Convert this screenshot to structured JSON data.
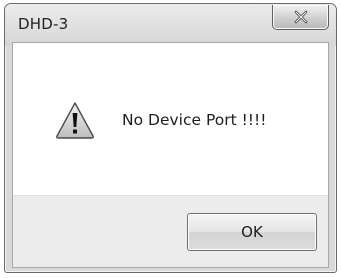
{
  "window": {
    "title": "DHD-3"
  },
  "dialog": {
    "icon": "warning-icon",
    "message": "No Device Port !!!!"
  },
  "buttons": {
    "ok_label": "OK",
    "close_icon": "close-icon"
  },
  "colors": {
    "title_bar": "#d9d9d9",
    "client_background": "#ffffff",
    "footer_background": "#ececec"
  }
}
